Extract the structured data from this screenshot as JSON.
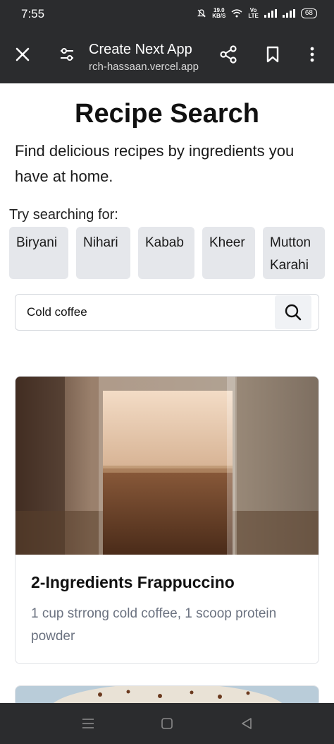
{
  "status_bar": {
    "time": "7:55",
    "net_speed_value": "19.0",
    "net_speed_unit": "KB/S",
    "volte_top": "Vo",
    "volte_bottom": "LTE",
    "battery": "68"
  },
  "browser": {
    "title": "Create Next App",
    "url": "rch-hassaan.vercel.app",
    "icons": [
      "close-icon",
      "tune-icon",
      "share-icon",
      "bookmark-icon",
      "more-vertical-icon"
    ]
  },
  "page": {
    "title": "Recipe Search",
    "subtitle": "Find delicious recipes by ingredients you have at home.",
    "try_label": "Try searching for:",
    "suggestions": [
      "Biryani",
      "Nihari",
      "Kabab",
      "Kheer",
      "Mutton Karahi"
    ],
    "search": {
      "value": "Cold coffee",
      "button_icon": "search-icon"
    },
    "results": [
      {
        "title": "2-Ingredients Frappuccino",
        "description": "1 cup strrong cold coffee, 1 scoop protein powder"
      }
    ]
  },
  "nav_bar": {
    "icons": [
      "menu-icon",
      "home-icon",
      "back-icon"
    ]
  },
  "colors": {
    "bar_background": "#2b2c2e",
    "chip_background": "#e5e7eb",
    "muted_text": "#6b7280"
  }
}
